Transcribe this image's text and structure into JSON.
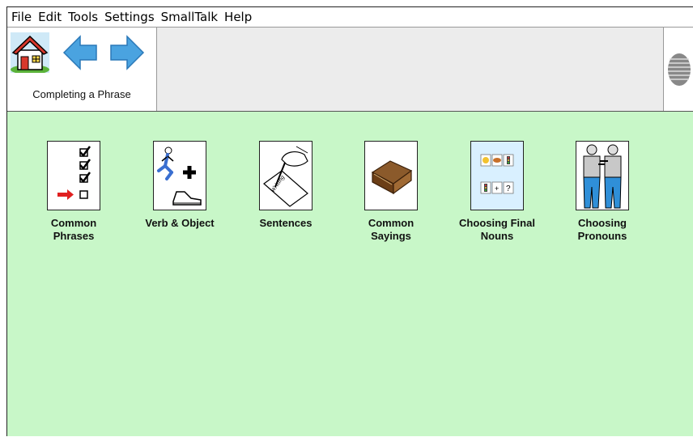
{
  "menu": [
    "File",
    "Edit",
    "Tools",
    "Settings",
    "SmallTalk",
    "Help"
  ],
  "nav": {
    "caption": "Completing a Phrase"
  },
  "tiles": [
    {
      "label": "Common\nPhrases",
      "icon": "checklist-icon"
    },
    {
      "label": "Verb & Object",
      "icon": "runner-shoe-icon"
    },
    {
      "label": "Sentences",
      "icon": "writing-hand-icon"
    },
    {
      "label": "Common\nSayings",
      "icon": "book-icon"
    },
    {
      "label": "Choosing Final\nNouns",
      "icon": "symbol-grid-icon"
    },
    {
      "label": "Choosing\nPronouns",
      "icon": "two-men-icon"
    }
  ],
  "colors": {
    "background": "#c8f7c8",
    "nav_arrow": "#4aa3e0"
  }
}
